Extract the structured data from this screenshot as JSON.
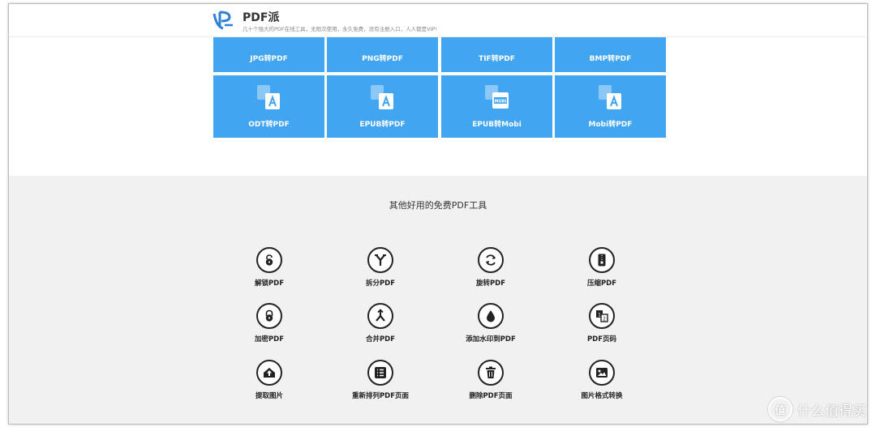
{
  "header": {
    "brand": "PDF派",
    "tagline": "几十个强大的PDF在线工具，无限次使用，永久免费，没有注册入口，人人都是VIP!"
  },
  "converters": [
    {
      "label": "JPG转PDF",
      "icon": "jpg-to-pdf-icon"
    },
    {
      "label": "PNG转PDF",
      "icon": "png-to-pdf-icon"
    },
    {
      "label": "TIF转PDF",
      "icon": "tif-to-pdf-icon"
    },
    {
      "label": "BMP转PDF",
      "icon": "bmp-to-pdf-icon"
    },
    {
      "label": "ODT转PDF",
      "icon": "odt-to-pdf-icon"
    },
    {
      "label": "EPUB转PDF",
      "icon": "epub-to-pdf-icon"
    },
    {
      "label": "EPUB转Mobi",
      "icon": "epub-to-mobi-icon",
      "badge": "MOBI"
    },
    {
      "label": "Mobi转PDF",
      "icon": "mobi-to-pdf-icon"
    }
  ],
  "tools_section": {
    "title": "其他好用的免费PDF工具",
    "tools": [
      {
        "label": "解锁PDF",
        "icon": "unlock-icon"
      },
      {
        "label": "拆分PDF",
        "icon": "split-icon"
      },
      {
        "label": "旋转PDF",
        "icon": "rotate-icon"
      },
      {
        "label": "压缩PDF",
        "icon": "compress-icon"
      },
      {
        "label": "加密PDF",
        "icon": "lock-icon"
      },
      {
        "label": "合并PDF",
        "icon": "merge-icon"
      },
      {
        "label": "添加水印到PDF",
        "icon": "watermark-drop-icon"
      },
      {
        "label": "PDF页码",
        "icon": "page-number-icon"
      },
      {
        "label": "提取图片",
        "icon": "extract-image-icon"
      },
      {
        "label": "重新排列PDF页面",
        "icon": "reorder-list-icon"
      },
      {
        "label": "删除PDF页面",
        "icon": "trash-icon"
      },
      {
        "label": "图片格式转换",
        "icon": "image-convert-icon"
      }
    ]
  },
  "watermark": {
    "text": "什么值得买",
    "mark": "值"
  },
  "colors": {
    "tile": "#42a5f2",
    "gray_bg": "#f1f1f1"
  }
}
